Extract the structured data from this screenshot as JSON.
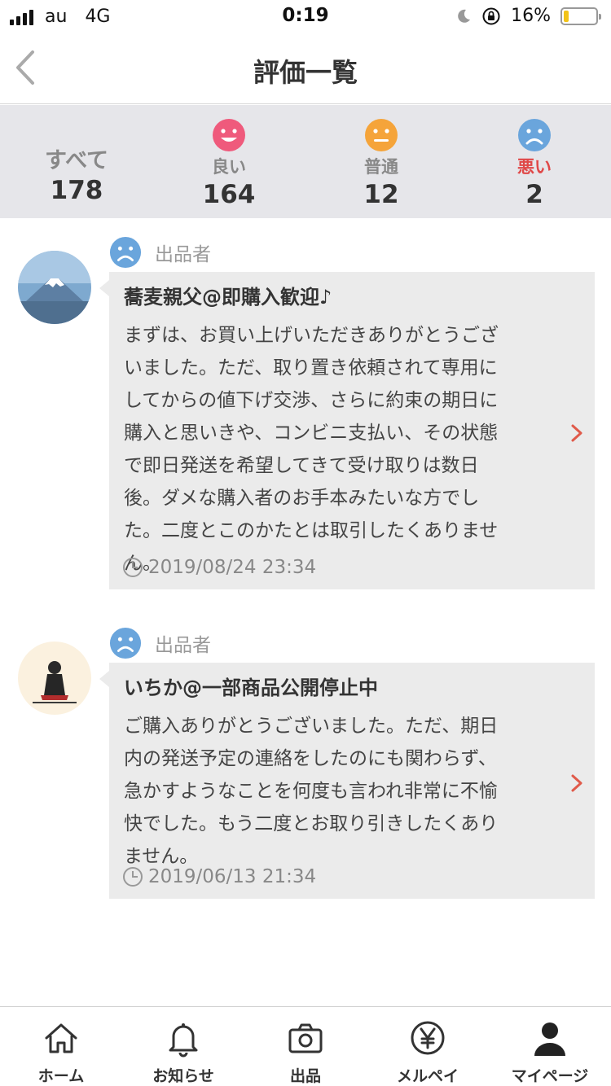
{
  "status_bar": {
    "carrier": "au",
    "network": "4G",
    "time": "0:19",
    "battery": "16%",
    "battery_level": 0.16
  },
  "header": {
    "title": "評価一覧"
  },
  "tabs": [
    {
      "label": "すべて",
      "count": "178"
    },
    {
      "label": "良い",
      "count": "164",
      "color": "#ef5a7c"
    },
    {
      "label": "普通",
      "count": "12",
      "color": "#f5a43a"
    },
    {
      "label": "悪い",
      "count": "2",
      "color": "#6aa5dc",
      "selected": true,
      "label_color": "#e04848"
    }
  ],
  "reviews": [
    {
      "role": "出品者",
      "name": "蕎麦親父@即購入歓迎♪",
      "comment": "まずは、お買い上げいただきありがとうござ\nいました。ただ、取り置き依頼されて専用に\nしてからの値下げ交渉、さらに約束の期日に\n購入と思いきや、コンビニ支払い、その状態\nで即日発送を希望してきて受け取りは数日\n後。ダメな購入者のお手本みたいな方でし\nた。二度とこのかたとは取引したくありませ\nん。",
      "date": "2019/08/24 23:34"
    },
    {
      "role": "出品者",
      "name": "いちか@一部商品公開停止中",
      "comment": "ご購入ありがとうございました。ただ、期日\n内の発送予定の連絡をしたのにも関わらず、\n急かすようなことを何度も言われ非常に不愉\n快でした。もう二度とお取り引きしたくあり\nません。",
      "date": "2019/06/13 21:34"
    }
  ],
  "tab_bar": [
    {
      "label": "ホーム",
      "icon": "home-icon"
    },
    {
      "label": "お知らせ",
      "icon": "bell-icon"
    },
    {
      "label": "出品",
      "icon": "camera-icon"
    },
    {
      "label": "メルペイ",
      "icon": "yen-icon"
    },
    {
      "label": "マイページ",
      "icon": "person-icon"
    }
  ]
}
